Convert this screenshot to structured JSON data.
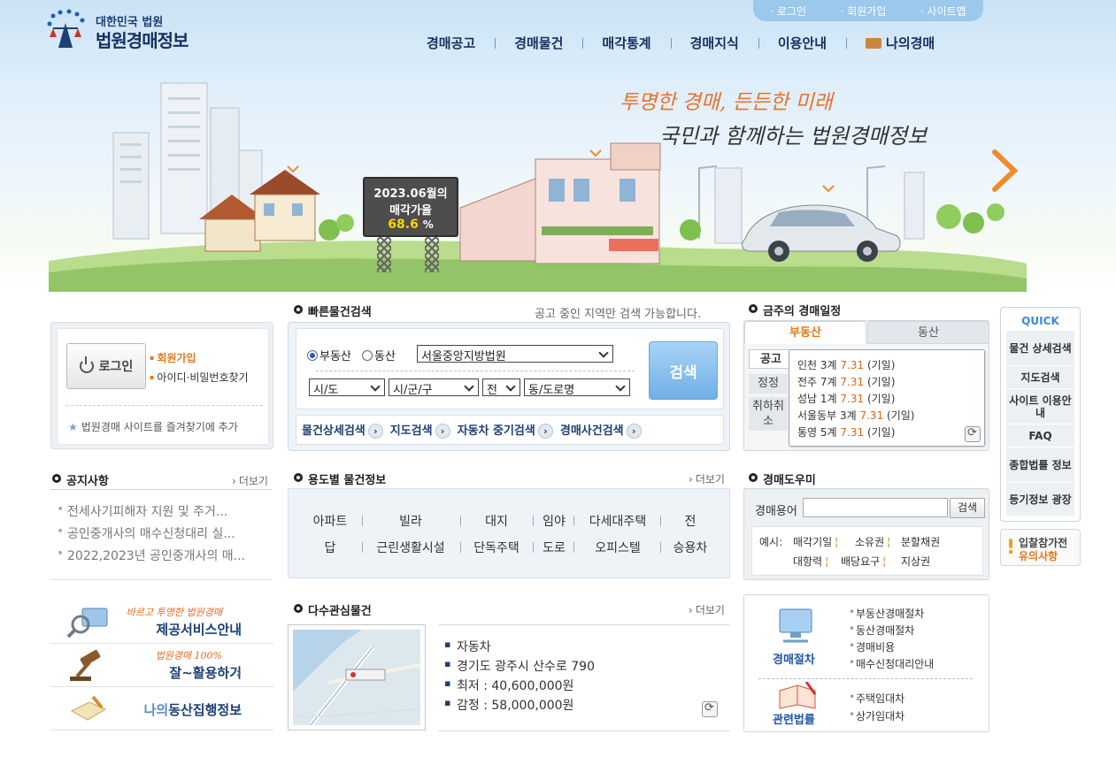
{
  "header": {
    "logo_sub": "대한민국 법원",
    "logo_main": "법원경매정보",
    "util_links": [
      "로그인",
      "회원가입",
      "사이트맵"
    ],
    "nav": [
      "경매공고",
      "경매물건",
      "매각통계",
      "경매지식",
      "이용안내",
      "나의경매"
    ]
  },
  "hero": {
    "slogan_line1": "투명한 경매, 든든한 미래",
    "slogan_line2": "국민과 함께하는 법원경매정보",
    "billboard_line1": "2023.06월의",
    "billboard_line2": "매각가율",
    "billboard_rate": "68.6",
    "billboard_unit": "%"
  },
  "login": {
    "button": "로그인",
    "join": "회원가입",
    "find": "아이디·비밀번호찾기",
    "favorite": "법원경매 사이트를 즐겨찾기에 추가"
  },
  "notice": {
    "title": "공지사항",
    "more": "더보기",
    "items": [
      "전세사기피해자 지원 및 주거...",
      "공인중개사의 매수신청대리 실...",
      "2022,2023년 공인중개사의 매..."
    ]
  },
  "banners": [
    {
      "tag": "바르고 투명한 법원경매",
      "main": "제공서비스안내"
    },
    {
      "tag": "법원경매 100%",
      "main": "잘~활용하기"
    },
    {
      "tag": "",
      "main_prefix": "나의",
      "main": "동산집행정보"
    }
  ],
  "quick_search": {
    "title": "빠른물건검색",
    "note": "공고 중인 지역만 검색 가능합니다.",
    "radio_realestate": "부동산",
    "radio_movable": "동산",
    "court": "서울중앙지방법원",
    "sido": "시/도",
    "sigungu": "시/군/구",
    "eupmyeon": "전",
    "dong": "동/도로명",
    "search_button": "검색",
    "tabs": [
      "물건상세검색",
      "지도검색",
      "자동차 중기검색",
      "경매사건검색"
    ]
  },
  "usage": {
    "title": "용도별 물건정보",
    "more": "더보기",
    "row1": [
      "아파트",
      "빌라",
      "대지",
      "임야",
      "다세대주택",
      "전"
    ],
    "row2": [
      "답",
      "근린생활시설",
      "단독주택",
      "도로",
      "오피스텔",
      "승용차"
    ]
  },
  "popular": {
    "title": "다수관심물건",
    "more": "더보기",
    "items": [
      "자동차",
      "경기도 광주시 산수로 790",
      "최저 : 40,600,000원",
      "감정 : 58,000,000원"
    ]
  },
  "schedule": {
    "title": "금주의 경매일정",
    "tab_realestate": "부동산",
    "tab_movable": "동산",
    "kinds": [
      "공고",
      "정정",
      "취하취소"
    ],
    "rows": [
      {
        "court": "인천 3계",
        "date": "7.31",
        "type": "(기일)"
      },
      {
        "court": "전주 7계",
        "date": "7.31",
        "type": "(기일)"
      },
      {
        "court": "성남 1계",
        "date": "7.31",
        "type": "(기일)"
      },
      {
        "court": "서울동부 3계",
        "date": "7.31",
        "type": "(기일)"
      },
      {
        "court": "통영 5계",
        "date": "7.31",
        "type": "(기일)"
      }
    ]
  },
  "helper": {
    "title": "경매도우미",
    "label": "경매용어",
    "button": "검색",
    "example_prefix": "예시:",
    "examples": [
      "매각기일",
      "소유권",
      "분할채권",
      "대항력",
      "배당요구",
      "지상권"
    ]
  },
  "procedure": {
    "label1": "경매절차",
    "links1": [
      "부동산경매절차",
      "동산경매절차",
      "경매비용",
      "매수신청대리안내"
    ],
    "label2": "관련법률",
    "links2": [
      "주택임대차",
      "상가임대차"
    ]
  },
  "quick_menu": {
    "title": "QUICK",
    "items": [
      "물건 상세검색",
      "지도검색",
      "사이트 이용안내",
      "FAQ",
      "종합법률 정보",
      "등기정보 광장"
    ]
  },
  "warning": {
    "line1": "입찰참가전",
    "line2": "유의사항"
  }
}
